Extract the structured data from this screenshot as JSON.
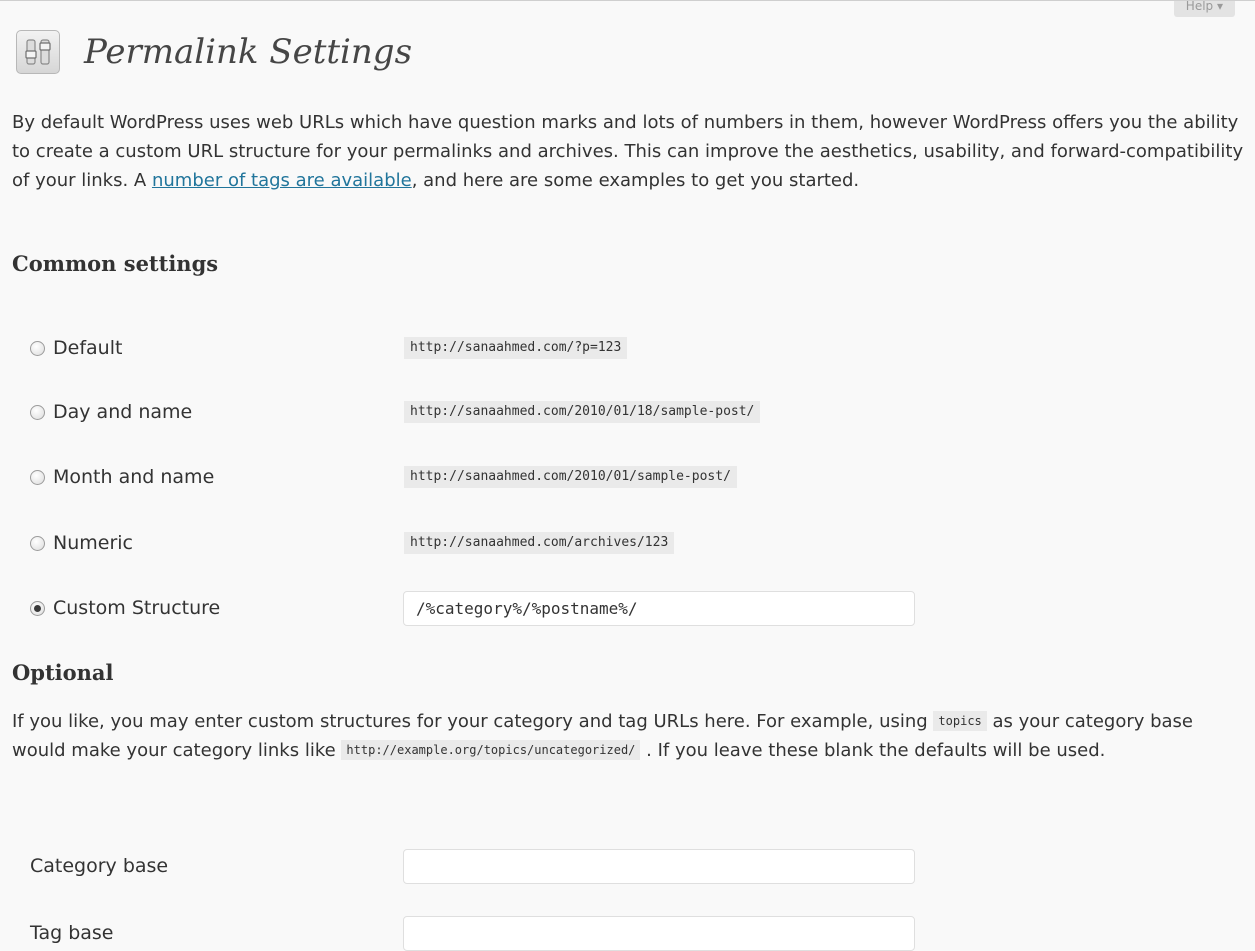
{
  "header": {
    "title": "Permalink Settings",
    "help_label": "Help ▾",
    "icon": "settings-sliders-icon"
  },
  "intro": {
    "text_before_link": "By default WordPress uses web URLs which have question marks and lots of numbers in them, however WordPress offers you the ability to create a custom URL structure for your permalinks and archives. This can improve the aesthetics, usability, and forward-compatibility of your links. A ",
    "link_text": "number of tags are available",
    "text_after_link": ", and here are some examples to get you started."
  },
  "common": {
    "heading": "Common settings",
    "options": [
      {
        "label": "Default",
        "example": "http://sanaahmed.com/?p=123",
        "checked": false
      },
      {
        "label": "Day and name",
        "example": "http://sanaahmed.com/2010/01/18/sample-post/",
        "checked": false
      },
      {
        "label": "Month and name",
        "example": "http://sanaahmed.com/2010/01/sample-post/",
        "checked": false
      },
      {
        "label": "Numeric",
        "example": "http://sanaahmed.com/archives/123",
        "checked": false
      },
      {
        "label": "Custom Structure",
        "value": "/%category%/%postname%/",
        "checked": true
      }
    ]
  },
  "optional": {
    "heading": "Optional",
    "text_1": "If you like, you may enter custom structures for your category and tag URLs here. For example, using ",
    "code_1": "topics",
    "text_2": " as your category base would make your category links like ",
    "code_2": "http://example.org/topics/uncategorized/",
    "text_3": " . If you leave these blank the defaults will be used.",
    "category_base_label": "Category base",
    "category_base_value": "",
    "tag_base_label": "Tag base",
    "tag_base_value": ""
  },
  "colors": {
    "link": "#21759b",
    "background": "#f9f9f9",
    "code_background": "#eaeaea"
  }
}
